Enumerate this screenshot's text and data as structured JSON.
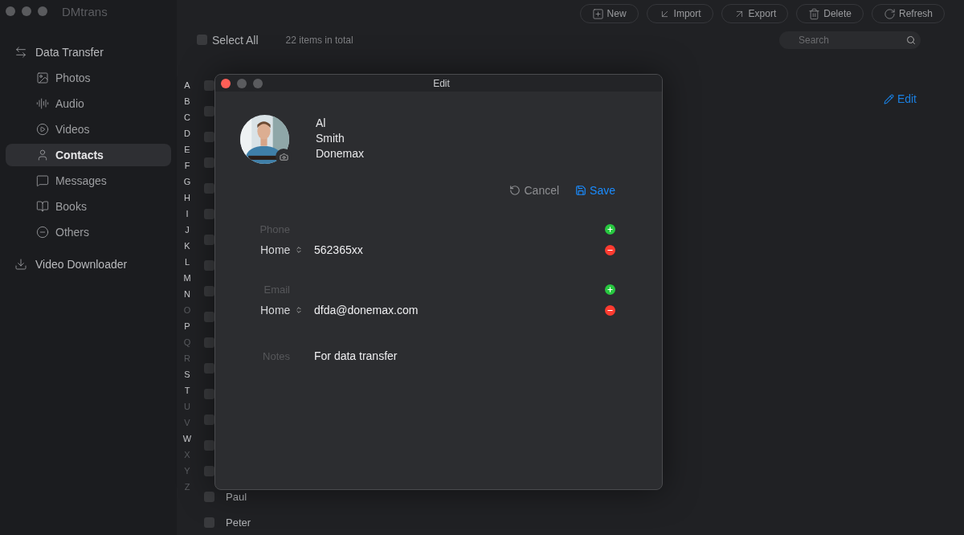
{
  "app": {
    "title": "DMtrans"
  },
  "sidebar": {
    "items": [
      {
        "label": "Data Transfer",
        "selected": false,
        "children": [
          {
            "label": "Photos",
            "selected": false
          },
          {
            "label": "Audio",
            "selected": false
          },
          {
            "label": "Videos",
            "selected": false
          },
          {
            "label": "Contacts",
            "selected": true
          },
          {
            "label": "Messages",
            "selected": false
          },
          {
            "label": "Books",
            "selected": false
          },
          {
            "label": "Others",
            "selected": false
          }
        ]
      },
      {
        "label": "Video Downloader",
        "selected": false
      }
    ]
  },
  "toolbar": [
    "New",
    "Import",
    "Export",
    "Delete",
    "Refresh"
  ],
  "list_header": {
    "select_all": {
      "label": "Select All",
      "checked": false
    },
    "count": "22 items in total",
    "search": {
      "placeholder": "Search"
    }
  },
  "edit_link": "Edit",
  "index_letters": [
    {
      "letter": "A",
      "disabled": false
    },
    {
      "letter": "B",
      "disabled": false
    },
    {
      "letter": "C",
      "disabled": false
    },
    {
      "letter": "D",
      "disabled": false
    },
    {
      "letter": "E",
      "disabled": false
    },
    {
      "letter": "F",
      "disabled": false
    },
    {
      "letter": "G",
      "disabled": false
    },
    {
      "letter": "H",
      "disabled": false
    },
    {
      "letter": "I",
      "disabled": false
    },
    {
      "letter": "J",
      "disabled": false
    },
    {
      "letter": "K",
      "disabled": false
    },
    {
      "letter": "L",
      "disabled": false
    },
    {
      "letter": "M",
      "disabled": false
    },
    {
      "letter": "N",
      "disabled": false
    },
    {
      "letter": "O",
      "disabled": true
    },
    {
      "letter": "P",
      "disabled": false
    },
    {
      "letter": "Q",
      "disabled": true
    },
    {
      "letter": "R",
      "disabled": true
    },
    {
      "letter": "S",
      "disabled": false
    },
    {
      "letter": "T",
      "disabled": false
    },
    {
      "letter": "U",
      "disabled": true
    },
    {
      "letter": "V",
      "disabled": true
    },
    {
      "letter": "W",
      "disabled": false
    },
    {
      "letter": "X",
      "disabled": true
    },
    {
      "letter": "Y",
      "disabled": true
    },
    {
      "letter": "Z",
      "disabled": true
    }
  ],
  "contacts": [
    {
      "checked": false
    },
    {
      "checked": false
    },
    {
      "checked": false
    },
    {
      "checked": false
    },
    {
      "checked": false
    },
    {
      "checked": false
    },
    {
      "checked": false
    },
    {
      "checked": false
    },
    {
      "checked": false
    },
    {
      "checked": false
    },
    {
      "checked": false
    },
    {
      "checked": false
    },
    {
      "checked": false
    },
    {
      "checked": false
    },
    {
      "checked": false
    },
    {
      "checked": false
    },
    {
      "name": "Paul",
      "checked": false
    },
    {
      "name": "Peter",
      "checked": false
    }
  ],
  "dialog": {
    "title": "Edit",
    "avatar": {
      "kind": "picture"
    },
    "name_lines": [
      "Al",
      "Smith",
      "Donemax"
    ],
    "actions": [
      "Cancel",
      "Save"
    ],
    "groups": [
      {
        "label": "Phone",
        "entries": [
          {
            "type": "Home",
            "value": "562365xx"
          }
        ]
      },
      {
        "label": "Email",
        "entries": [
          {
            "type": "Home",
            "value": "dfda@donemax.com"
          }
        ]
      }
    ],
    "notes": {
      "label": "Notes",
      "value": "For data transfer"
    }
  }
}
